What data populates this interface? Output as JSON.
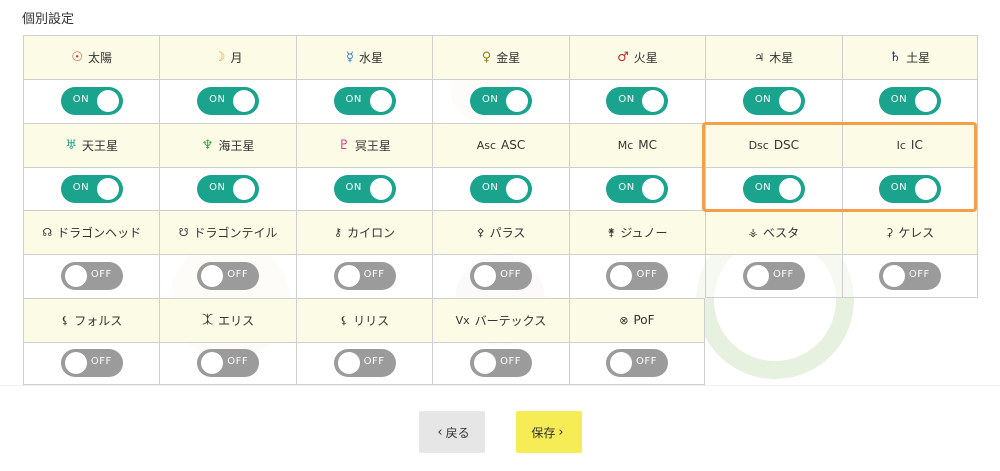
{
  "heading": "個別設定",
  "bodies": [
    {
      "name": "太陽",
      "symbol": "☉",
      "color_class": "red",
      "state": "ON"
    },
    {
      "name": "月",
      "symbol": "☽",
      "color_class": "orange",
      "state": "ON"
    },
    {
      "name": "水星",
      "symbol": "☿",
      "color_class": "blue",
      "state": "ON"
    },
    {
      "name": "金星",
      "symbol": "♀",
      "color_class": "gold",
      "state": "ON"
    },
    {
      "name": "火星",
      "symbol": "♂",
      "color_class": "darkred",
      "state": "ON"
    },
    {
      "name": "木星",
      "symbol": "♃",
      "color_class": "dark",
      "state": "ON"
    },
    {
      "name": "土星",
      "symbol": "♄",
      "color_class": "navy",
      "state": "ON"
    },
    {
      "name": "天王星",
      "symbol": "♅",
      "color_class": "teal",
      "state": "ON"
    },
    {
      "name": "海王星",
      "symbol": "♆",
      "color_class": "green",
      "state": "ON"
    },
    {
      "name": "冥王星",
      "symbol": "♇",
      "color_class": "magenta",
      "state": "ON"
    },
    {
      "name": "ASC",
      "symbol": "Asc",
      "color_class": "dark",
      "state": "ON"
    },
    {
      "name": "MC",
      "symbol": "Mc",
      "color_class": "dark",
      "state": "ON"
    },
    {
      "name": "DSC",
      "symbol": "Dsc",
      "color_class": "dark",
      "state": "ON"
    },
    {
      "name": "IC",
      "symbol": "Ic",
      "color_class": "dark",
      "state": "ON"
    },
    {
      "name": "ドラゴンヘッド",
      "symbol": "☊",
      "color_class": "dark",
      "state": "OFF"
    },
    {
      "name": "ドラゴンテイル",
      "symbol": "☋",
      "color_class": "dark",
      "state": "OFF"
    },
    {
      "name": "カイロン",
      "symbol": "⚷",
      "color_class": "dark",
      "state": "OFF"
    },
    {
      "name": "パラス",
      "symbol": "⚴",
      "color_class": "dark",
      "state": "OFF"
    },
    {
      "name": "ジュノー",
      "symbol": "⚵",
      "color_class": "dark",
      "state": "OFF"
    },
    {
      "name": "ベスタ",
      "symbol": "⚶",
      "color_class": "dark",
      "state": "OFF"
    },
    {
      "name": "ケレス",
      "symbol": "⚳",
      "color_class": "dark",
      "state": "OFF"
    },
    {
      "name": "フォルス",
      "symbol": "⚸",
      "color_class": "dark",
      "state": "OFF"
    },
    {
      "name": "エリス",
      "symbol": "⯰",
      "color_class": "dark",
      "state": "OFF"
    },
    {
      "name": "リリス",
      "symbol": "⚸",
      "color_class": "dark",
      "state": "OFF"
    },
    {
      "name": "バーテックス",
      "symbol": "Vx",
      "color_class": "dark",
      "state": "OFF"
    },
    {
      "name": "PoF",
      "symbol": "⊗",
      "color_class": "dark",
      "state": "OFF"
    }
  ],
  "footer": {
    "back_label": "戻る",
    "save_label": "保存"
  },
  "colors": {
    "toggle_on": "#1aa38d",
    "toggle_off": "#9b9b9b",
    "header_bg": "#fbfbe6",
    "highlight": "#f4a04a",
    "save_btn": "#f6ec55",
    "back_btn": "#e6e6e6"
  }
}
